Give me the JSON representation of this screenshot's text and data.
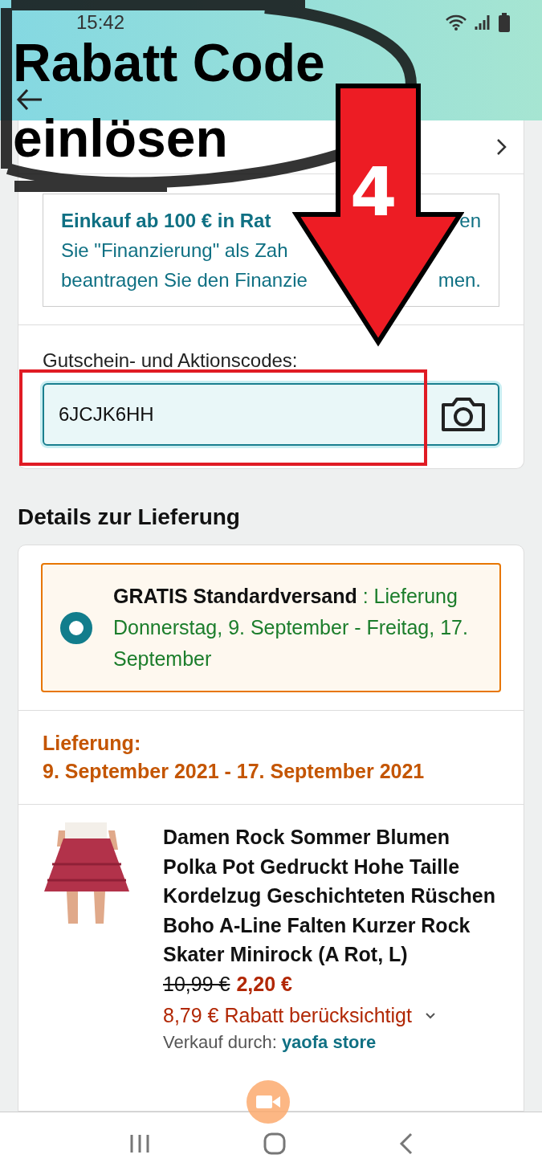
{
  "status_bar": {
    "time": "15:42"
  },
  "overlay": {
    "title_lines": [
      "Rabatt Code",
      "einlösen"
    ],
    "step": "4"
  },
  "notice": {
    "lines": [
      {
        "left": "Einkauf ab 100 € in Rat",
        "bold": true,
        "right": "en"
      },
      {
        "left": "Sie \"Finanzierung\" als Zah",
        "bold": false
      },
      {
        "left": "beantragen Sie den Finanzie",
        "bold": false,
        "right": "men."
      }
    ]
  },
  "coupon": {
    "label": "Gutschein- und Aktionscodes:",
    "value": "6JCJK6HH"
  },
  "delivery": {
    "heading": "Details zur Lieferung",
    "option": {
      "selected": true,
      "text": "**GRATIS Standardversand** : Lieferung Donnerstag, 9. September - Freitag, 17. September"
    },
    "date_label": "Lieferung:",
    "date_range": "9. September 2021 - 17. September 2021"
  },
  "product": {
    "title": "Damen Rock Sommer Blumen Polka Pot Gedruckt Hohe Taille Kordelzug Geschichteten Rüschen Boho A-Line Falten Kurzer Rock Skater Minirock (A Rot, L)",
    "old_price": "10,99 €",
    "price": "2,20 €",
    "discount": "8,79 € Rabatt berücksichtigt",
    "seller_label": "Verkauf durch:",
    "seller": "yaofa store"
  }
}
